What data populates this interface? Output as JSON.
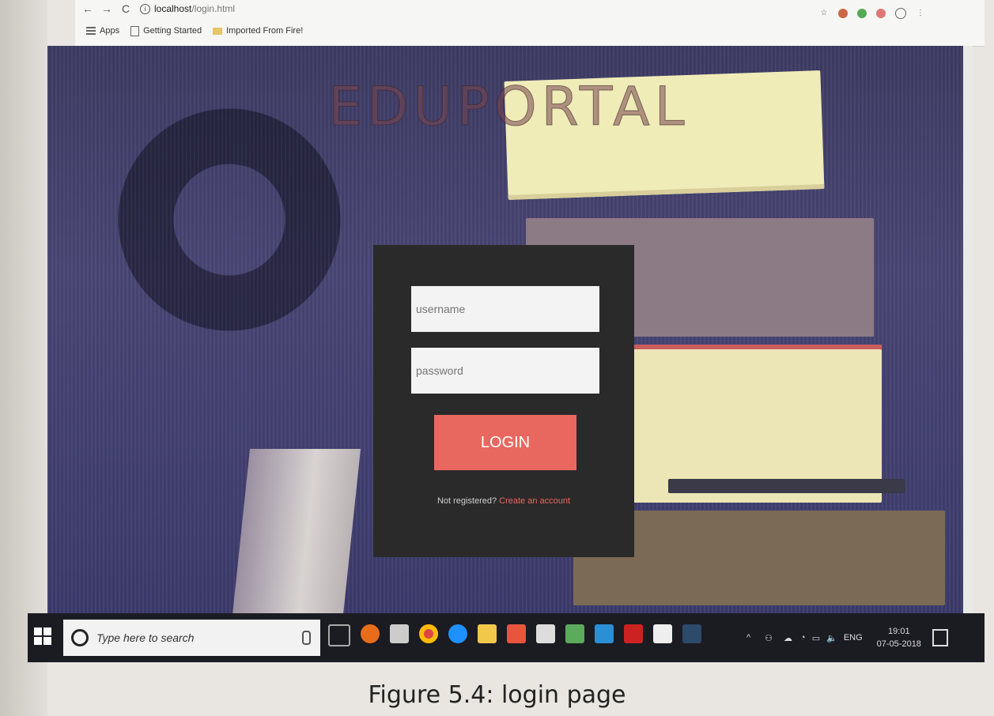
{
  "browser": {
    "url_host": "localhost",
    "url_path": "/login.html",
    "bookmarks": [
      {
        "label": "Apps",
        "icon": "apps-grid-icon"
      },
      {
        "label": "Getting Started",
        "icon": "page-icon"
      },
      {
        "label": "Imported From Fire!",
        "icon": "folder-icon"
      }
    ]
  },
  "site": {
    "brand": "EDUPORTAL"
  },
  "login": {
    "username_placeholder": "username",
    "password_placeholder": "password",
    "button_label": "LOGIN",
    "not_registered": "Not registered?",
    "create_account": "Create an account"
  },
  "taskbar": {
    "search_placeholder": "Type here to search",
    "language": "ENG",
    "time": "19:01",
    "date": "07-05-2018"
  },
  "caption": "Figure 5.4: login page",
  "colors": {
    "accent": "#e8685f",
    "panel": "#2a2a2a"
  }
}
